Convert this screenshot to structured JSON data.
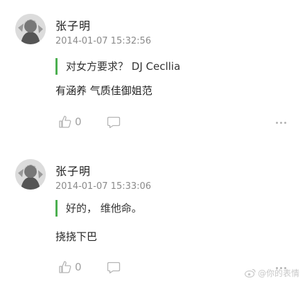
{
  "posts": [
    {
      "username": "张子明",
      "timestamp": "2014-01-07 15:32:56",
      "quote": "对女方要求？ DJ Cecllia",
      "reply": "有涵养 气质佳御姐范",
      "like_count": "0"
    },
    {
      "username": "张子明",
      "timestamp": "2014-01-07 15:33:06",
      "quote": "好的， 维他命。",
      "reply": "挠挠下巴",
      "like_count": "0"
    }
  ],
  "watermark": "@你的表情",
  "colors": {
    "quote_bar": "#4caf50",
    "meta": "#8a8a8a",
    "icon": "#b4b4b4"
  },
  "icons": [
    "avatar",
    "thumbs-up-icon",
    "comment-icon",
    "more-icon",
    "weibo-logo"
  ]
}
